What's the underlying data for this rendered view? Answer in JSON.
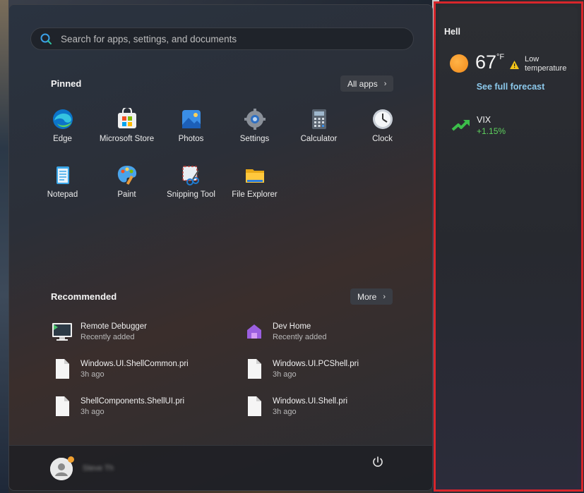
{
  "search": {
    "placeholder": "Search for apps, settings, and documents"
  },
  "pinned": {
    "title": "Pinned",
    "all_apps_label": "All apps",
    "apps": [
      {
        "label": "Edge",
        "icon": "edge-icon"
      },
      {
        "label": "Microsoft Store",
        "icon": "store-icon"
      },
      {
        "label": "Photos",
        "icon": "photos-icon"
      },
      {
        "label": "Settings",
        "icon": "settings-icon"
      },
      {
        "label": "Calculator",
        "icon": "calculator-icon"
      },
      {
        "label": "Clock",
        "icon": "clock-icon"
      },
      {
        "label": "Notepad",
        "icon": "notepad-icon"
      },
      {
        "label": "Paint",
        "icon": "paint-icon"
      },
      {
        "label": "Snipping Tool",
        "icon": "snipping-tool-icon"
      },
      {
        "label": "File Explorer",
        "icon": "file-explorer-icon"
      }
    ]
  },
  "recommended": {
    "title": "Recommended",
    "more_label": "More",
    "items": [
      {
        "name": "Remote Debugger",
        "sub": "Recently added",
        "icon": "remote-debugger-icon"
      },
      {
        "name": "Dev Home",
        "sub": "Recently added",
        "icon": "dev-home-icon"
      },
      {
        "name": "Windows.UI.ShellCommon.pri",
        "sub": "3h ago",
        "icon": "file-icon"
      },
      {
        "name": "Windows.UI.PCShell.pri",
        "sub": "3h ago",
        "icon": "file-icon"
      },
      {
        "name": "ShellComponents.ShellUI.pri",
        "sub": "3h ago",
        "icon": "file-icon"
      },
      {
        "name": "Windows.UI.Shell.pri",
        "sub": "3h ago",
        "icon": "file-icon"
      }
    ]
  },
  "footer": {
    "user_name": "Steve Th",
    "power_icon": "power-icon"
  },
  "widget": {
    "location": "Hell",
    "temperature": "67",
    "unit": "°F",
    "alert": "Low temperature",
    "forecast_link": "See full forecast",
    "stock": {
      "symbol": "VIX",
      "change": "+1.15%"
    }
  },
  "colors": {
    "accent": "#8cc9ec",
    "stock_up": "#5fd35f",
    "highlight_border": "#d8262b"
  }
}
